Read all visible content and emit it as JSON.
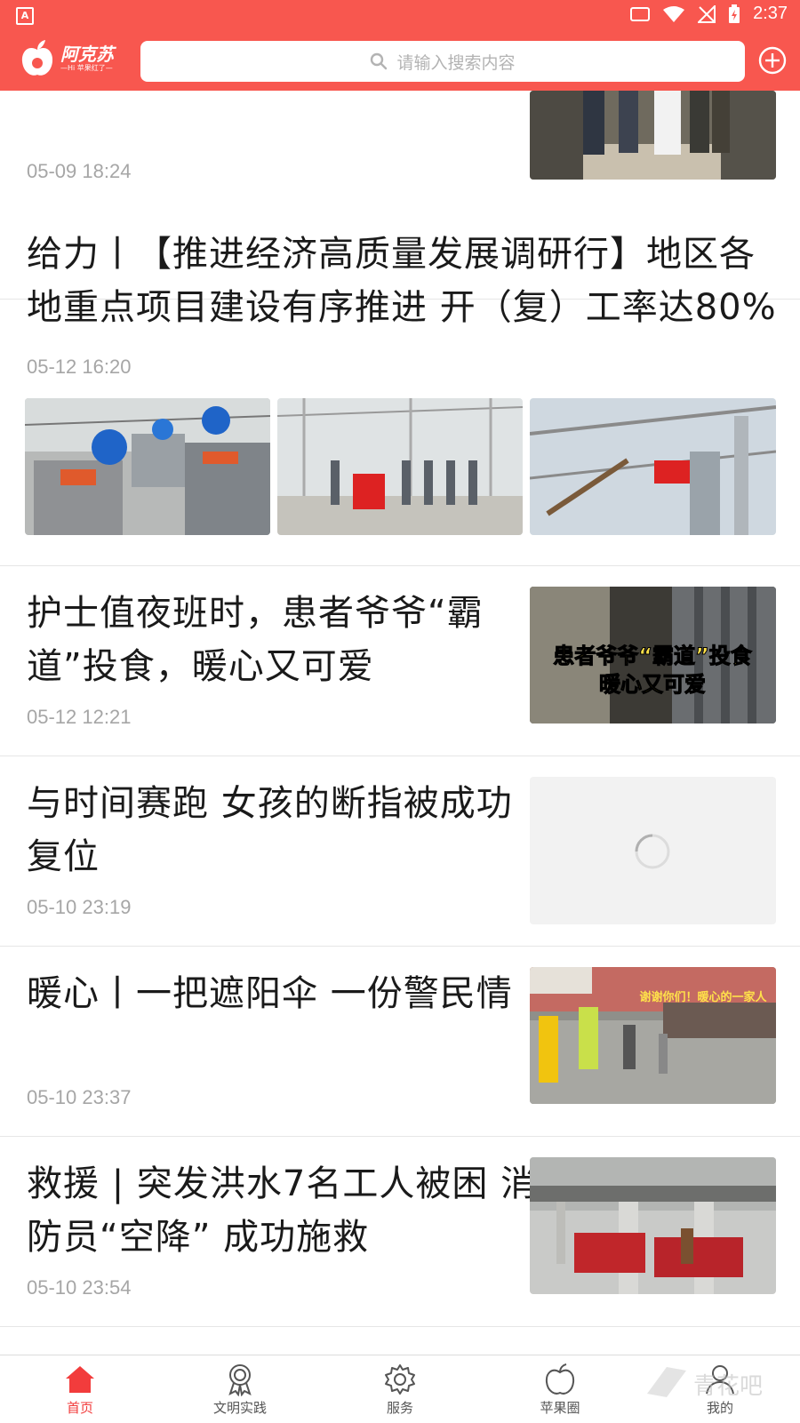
{
  "status_bar": {
    "time": "2:37"
  },
  "header": {
    "app_name": "阿克苏",
    "slogan": "—Hi 苹果红了—",
    "search_placeholder": "请输入搜索内容"
  },
  "feed": [
    {
      "time": "05-09 18:24"
    },
    {
      "title_lines": [
        "给力丨【推进经济高质量发展调研行】地区各",
        "地重点项目建设有序推进 开（复）工率达80%"
      ],
      "time": "05-12 16:20"
    },
    {
      "title_lines": [
        "护士值夜班时，患者爷爷“霸",
        "道”投食，暖心又可爱"
      ],
      "time": "05-12 12:21",
      "image_caption_lines": [
        "患者爷爷“霸道”投食",
        "暖心又可爱"
      ]
    },
    {
      "title_lines": [
        "与时间赛跑 女孩的断指被成功",
        "复位"
      ],
      "time": "05-10 23:19"
    },
    {
      "title_lines": [
        "暖心丨一把遮阳伞 一份警民情"
      ],
      "time": "05-10 23:37",
      "image_caption": "谢谢你们！暖心的一家人"
    },
    {
      "title_lines": [
        "救援 | 突发洪水7名工人被困 消",
        "防员“空降” 成功施救"
      ],
      "time": "05-10 23:54"
    }
  ],
  "bottom_nav": [
    {
      "label": "首页",
      "icon": "home-icon",
      "active": true
    },
    {
      "label": "文明实践",
      "icon": "medal-icon",
      "active": false
    },
    {
      "label": "服务",
      "icon": "gear-icon",
      "active": false
    },
    {
      "label": "苹果圈",
      "icon": "apple-icon",
      "active": false
    },
    {
      "label": "我的",
      "icon": "user-icon",
      "active": false
    }
  ],
  "watermark": "青花吧",
  "colors": {
    "brand": "#f8574f",
    "active_tab": "#f23c3c",
    "text": "#1a1a1a",
    "muted": "#a6a6a6"
  }
}
